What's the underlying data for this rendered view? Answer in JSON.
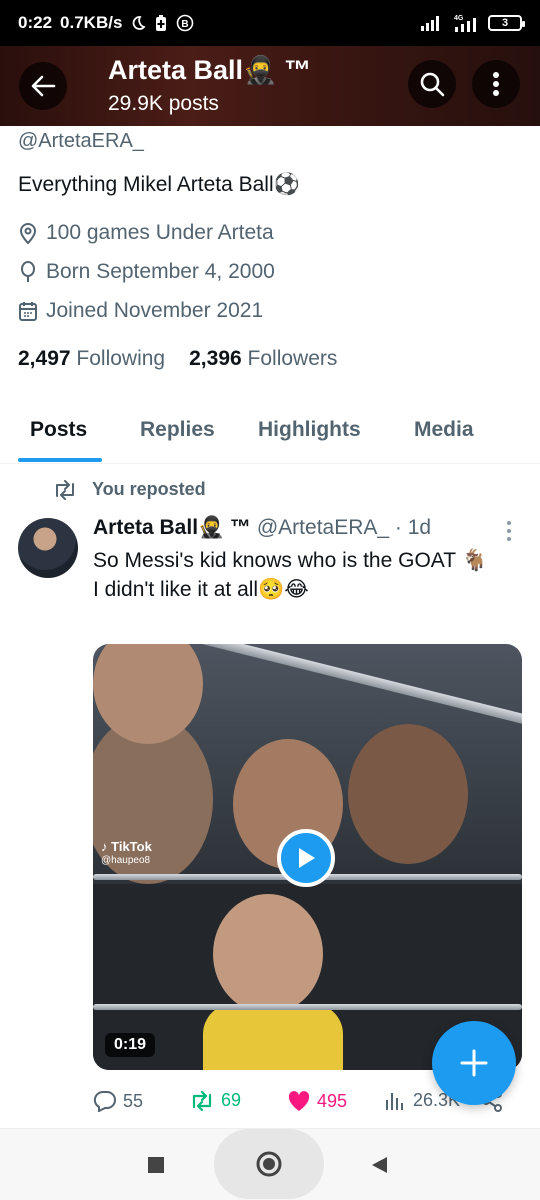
{
  "status": {
    "time": "0:22",
    "speed": "0.7KB/s",
    "battery": "3",
    "network_label": "4G"
  },
  "header": {
    "title": "Arteta Ball🥷 ™",
    "posts_count": "29.9K posts"
  },
  "profile": {
    "handle": "@ArtetaERA_",
    "bio": "Everything Mikel Arteta Ball⚽",
    "location": "100 games Under Arteta",
    "birthday": "Born September 4, 2000",
    "joined": "Joined November 2021",
    "following_count": "2,497",
    "following_label": "Following",
    "followers_count": "2,396",
    "followers_label": "Followers"
  },
  "tabs": [
    {
      "label": "Posts",
      "active": true
    },
    {
      "label": "Replies",
      "active": false
    },
    {
      "label": "Highlights",
      "active": false
    },
    {
      "label": "Media",
      "active": false
    }
  ],
  "post": {
    "repost_label": "You reposted",
    "author_name": "Arteta Ball🥷 ™",
    "author_handle": "@ArtetaERA_",
    "time": "· 1d",
    "text_line1": "So Messi's kid knows who is the GOAT 🐐",
    "text_line2": "I didn't like it at all🥺😂",
    "video": {
      "watermark": "TikTok",
      "watermark_user": "@haupeo8",
      "duration": "0:19"
    },
    "stats": {
      "replies": "55",
      "reposts": "69",
      "likes": "495",
      "views": "26.3K"
    }
  },
  "colors": {
    "accent": "#1d9bf0",
    "repost": "#00ba7c",
    "like": "#f91880",
    "secondary_text": "#536471"
  }
}
